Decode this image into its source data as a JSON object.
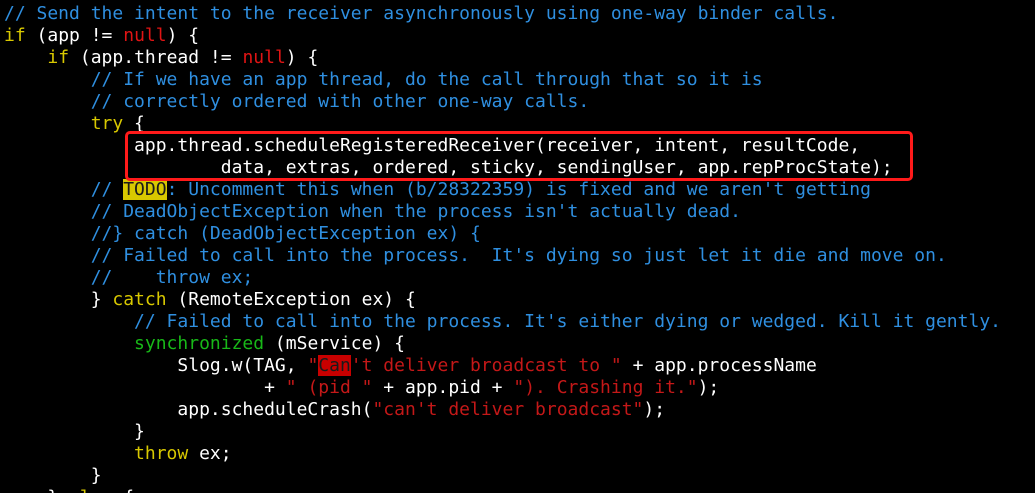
{
  "colors": {
    "background": "#000000",
    "comment": "#2f8fe0",
    "keyword": "#d8c800",
    "literal": "#e01414",
    "string": "#c41818",
    "annotation_box": "#ff1a1a"
  },
  "code": {
    "l1": "// Send the intent to the receiver asynchronously using one-way binder calls.",
    "l2_kw": "if",
    "l2_a": " (app != ",
    "l2_null": "null",
    "l2_b": ") {",
    "l3_indent": "    ",
    "l3_kw": "if",
    "l3_a": " (app.thread != ",
    "l3_null": "null",
    "l3_b": ") {",
    "l4": "        // If we have an app thread, do the call through that so it is",
    "l5": "        // correctly ordered with other one-way calls.",
    "l6_indent": "        ",
    "l6_kw": "try",
    "l6_b": " {",
    "l7": "            app.thread.scheduleRegisteredReceiver(receiver, intent, resultCode,",
    "l8": "                    data, extras, ordered, sticky, sendingUser, app.repProcState);",
    "l9_a": "        // ",
    "l9_todo": "TODO",
    "l9_b": ": Uncomment this when (b/28322359) is fixed and we aren't getting",
    "l10": "        // DeadObjectException when the process isn't actually dead.",
    "l11": "        //} catch (DeadObjectException ex) {",
    "l12": "        // Failed to call into the process.  It's dying so just let it die and move on.",
    "l13": "        //    throw ex;",
    "l14_a": "        } ",
    "l14_kw": "catch",
    "l14_b": " (RemoteException ex) {",
    "l15": "            // Failed to call into the process. It's either dying or wedged. Kill it gently.",
    "l16_indent": "            ",
    "l16_kw": "synchronized",
    "l16_b": " (mService) {",
    "l17_a": "                Slog.w(TAG, ",
    "l17_q": "\"",
    "l17_can": "Can",
    "l17_str": "'t deliver broadcast to \"",
    "l17_b": " + app.processName",
    "l18_a": "                        + ",
    "l18_s1": "\" (pid \"",
    "l18_b": " + app.pid + ",
    "l18_s2": "\"). Crashing it.\"",
    "l18_c": ");",
    "l19_a": "                app.scheduleCrash(",
    "l19_s": "\"can't deliver broadcast\"",
    "l19_b": ");",
    "l20": "            }",
    "l21_indent": "            ",
    "l21_kw": "throw",
    "l21_b": " ex;",
    "l22": "        }",
    "l23_a": "    } ",
    "l23_kw": "else",
    "l23_b": " {"
  }
}
